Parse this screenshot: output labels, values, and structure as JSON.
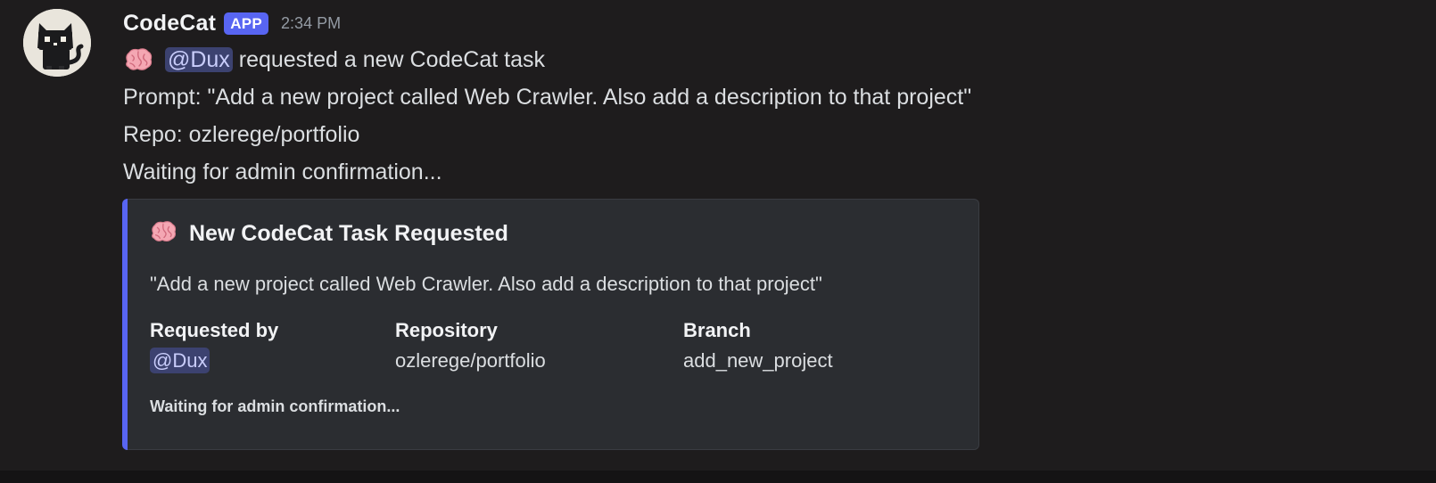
{
  "message": {
    "author": "CodeCat",
    "badge": "APP",
    "timestamp": "2:34 PM",
    "intro_mention": "@Dux",
    "intro_text": " requested a new CodeCat task",
    "prompt_line": "Prompt: \"Add a new project called Web Crawler. Also add a description to that project\"",
    "repo_line": "Repo: ozlerege/portfolio",
    "status_line": "Waiting for admin confirmation..."
  },
  "embed": {
    "accent_color": "#5865f2",
    "title": "New CodeCat Task Requested",
    "description": "\"Add a new project called Web Crawler. Also add a description to that project\"",
    "fields": [
      {
        "name": "Requested by",
        "value": "@Dux"
      },
      {
        "name": "Repository",
        "value": "ozlerege/portfolio"
      },
      {
        "name": "Branch",
        "value": "add_new_project"
      }
    ],
    "footer": "Waiting for admin confirmation..."
  },
  "icons": {
    "avatar": "black-cat-avatar",
    "emoji": "brain-emoji"
  }
}
